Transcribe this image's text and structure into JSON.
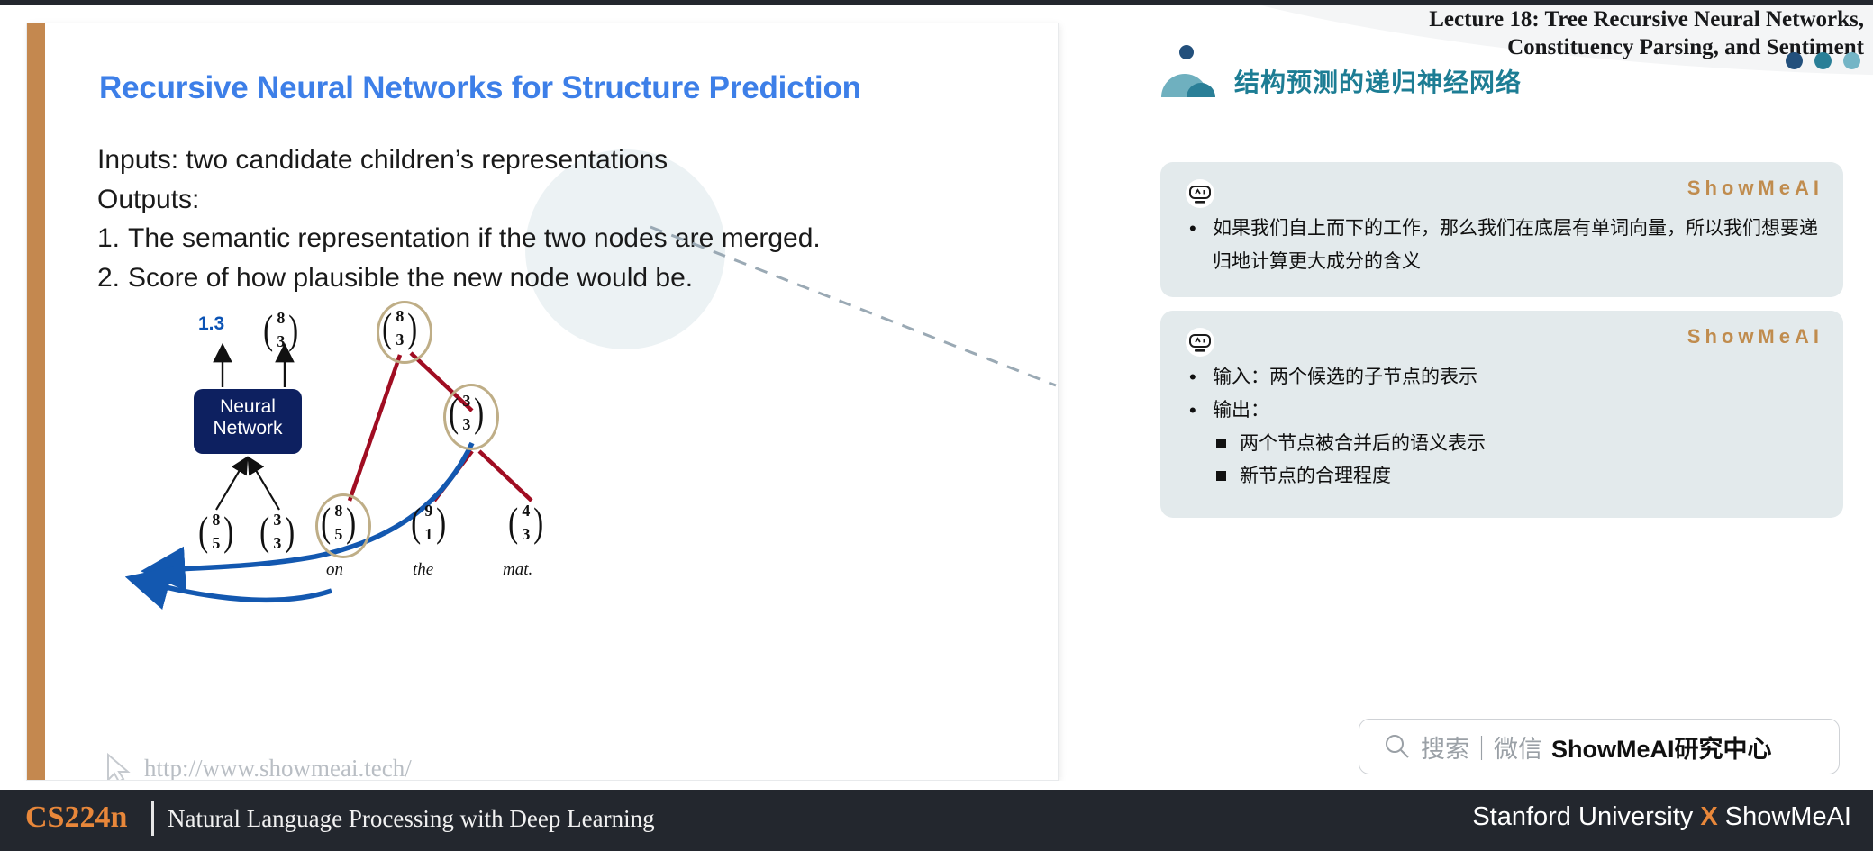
{
  "slide": {
    "title": "Recursive Neural Networks for Structure Prediction",
    "body_lines": [
      {
        "num": "",
        "text": "Inputs: two candidate children’s representations"
      },
      {
        "num": "",
        "text": "Outputs:"
      },
      {
        "num": "1.",
        "text": "The semantic representation if the two nodes are merged."
      },
      {
        "num": "2.",
        "text": "Score of how plausible the new node would be."
      }
    ],
    "watermark": "http://www.showmeai.tech/"
  },
  "diagram": {
    "score_label": "1.3",
    "nn_box_line1": "Neural",
    "nn_box_line2": "Network",
    "output_vector": [
      "8",
      "3"
    ],
    "input_vectors": [
      [
        "8",
        "5"
      ],
      [
        "3",
        "3"
      ]
    ],
    "tree": {
      "root": [
        "8",
        "3"
      ],
      "internal": [
        "3",
        "3"
      ],
      "leaves": [
        {
          "vector": [
            "8",
            "5"
          ],
          "word": "on"
        },
        {
          "vector": [
            "9",
            "1"
          ],
          "word": "the"
        },
        {
          "vector": [
            "4",
            "3"
          ],
          "word": "mat."
        }
      ]
    },
    "colors": {
      "node_ring": "#bfae87",
      "tree_edge": "#a00d22",
      "highlight_arrow": "#1358b0",
      "nn_box": "#0d2060",
      "score_text": "#0b53b5"
    }
  },
  "header": {
    "lecture_title_line1": "Lecture 18: Tree Recursive Neural Networks,",
    "lecture_title_line2": "Constituency Parsing, and Sentiment",
    "chinese_title": "结构预测的递归神经网络",
    "dot_colors": [
      "#23507c",
      "#2a7f97",
      "#74b5c6"
    ]
  },
  "callouts": [
    {
      "brand": "ShowMeAI",
      "items": [
        {
          "level": 1,
          "text": "如果我们自上而下的工作，那么我们在底层有单词向量，所以我们想要递归地计算更大成分的含义"
        }
      ]
    },
    {
      "brand": "ShowMeAI",
      "items": [
        {
          "level": 1,
          "text": "输入：两个候选的子节点的表示"
        },
        {
          "level": 1,
          "text": "输出："
        },
        {
          "level": 2,
          "text": "两个节点被合并后的语义表示"
        },
        {
          "level": 2,
          "text": "新节点的合理程度"
        }
      ]
    }
  ],
  "search": {
    "grey_text": "搜索｜微信",
    "bold_text": "ShowMeAI研究中心"
  },
  "footer": {
    "course_code": "CS224n",
    "course_name": "Natural Language Processing with Deep Learning",
    "right_prefix": "Stanford University ",
    "right_x": "X",
    "right_suffix": " ShowMeAI"
  }
}
